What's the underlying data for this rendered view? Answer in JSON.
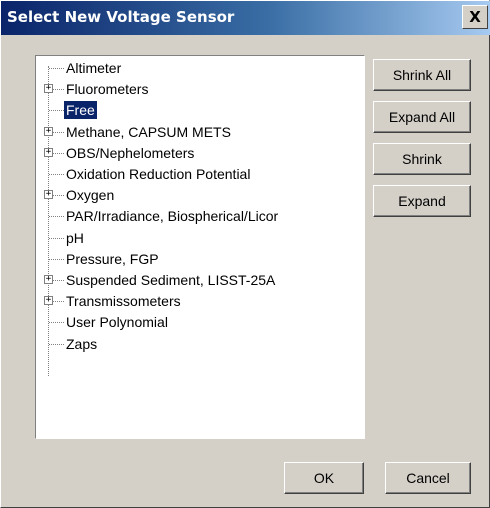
{
  "window": {
    "title": "Select New Voltage Sensor",
    "close_label": "X"
  },
  "tree": {
    "items": [
      {
        "label": "Altimeter",
        "expandable": false,
        "expander": "",
        "selected": false
      },
      {
        "label": "Fluorometers",
        "expandable": true,
        "expander": "+",
        "selected": false
      },
      {
        "label": "Free",
        "expandable": false,
        "expander": "",
        "selected": true
      },
      {
        "label": "Methane, CAPSUM METS",
        "expandable": true,
        "expander": "+",
        "selected": false
      },
      {
        "label": "OBS/Nephelometers",
        "expandable": true,
        "expander": "+",
        "selected": false
      },
      {
        "label": "Oxidation Reduction Potential",
        "expandable": false,
        "expander": "",
        "selected": false
      },
      {
        "label": "Oxygen",
        "expandable": true,
        "expander": "+",
        "selected": false
      },
      {
        "label": "PAR/Irradiance, Biospherical/Licor",
        "expandable": false,
        "expander": "",
        "selected": false
      },
      {
        "label": "pH",
        "expandable": false,
        "expander": "",
        "selected": false
      },
      {
        "label": "Pressure, FGP",
        "expandable": false,
        "expander": "",
        "selected": false
      },
      {
        "label": "Suspended Sediment, LISST-25A",
        "expandable": true,
        "expander": "+",
        "selected": false
      },
      {
        "label": "Transmissometers",
        "expandable": true,
        "expander": "+",
        "selected": false
      },
      {
        "label": "User Polynomial",
        "expandable": false,
        "expander": "",
        "selected": false
      },
      {
        "label": "Zaps",
        "expandable": false,
        "expander": "",
        "selected": false
      }
    ]
  },
  "buttons": {
    "shrink_all": "Shrink All",
    "expand_all": "Expand All",
    "shrink": "Shrink",
    "expand": "Expand",
    "ok": "OK",
    "cancel": "Cancel"
  }
}
